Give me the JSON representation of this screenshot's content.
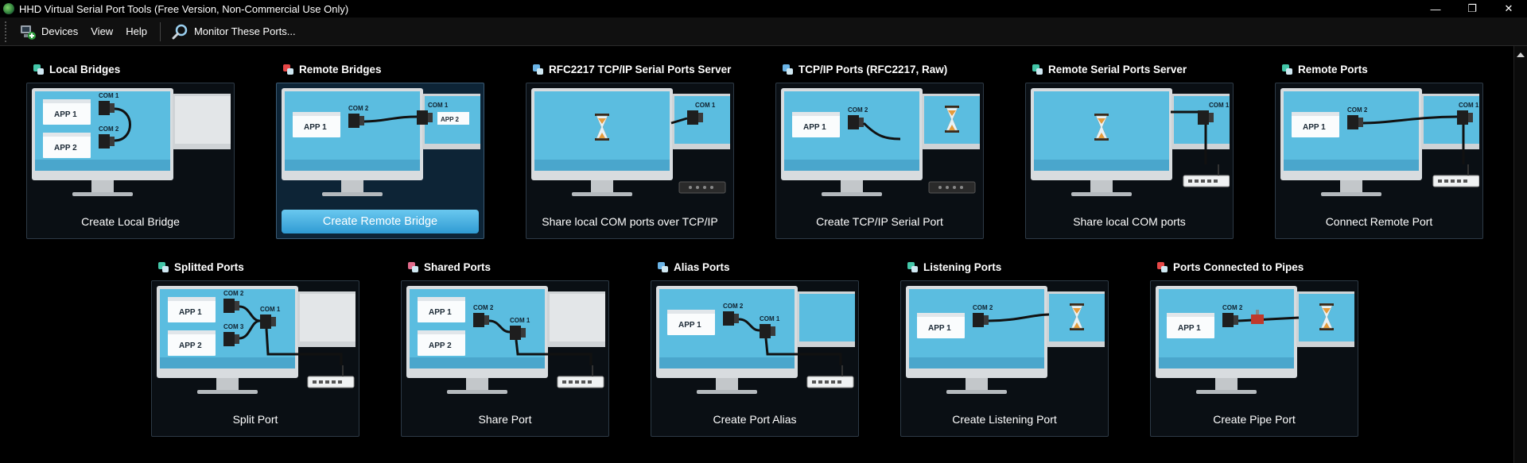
{
  "window": {
    "title": "HHD Virtual Serial Port Tools (Free Version, Non-Commercial Use Only)",
    "controls": {
      "minimize": "—",
      "restore": "❐",
      "close": "✕"
    }
  },
  "menu": {
    "devices": "Devices",
    "view": "View",
    "help": "Help",
    "monitor": "Monitor These Ports..."
  },
  "tiles": [
    {
      "title": "Local Bridges",
      "caption": "Create Local Bridge",
      "icon": "local-bridges-icon",
      "selected": false
    },
    {
      "title": "Remote Bridges",
      "caption": "Create Remote Bridge",
      "icon": "remote-bridges-icon",
      "selected": true
    },
    {
      "title": "RFC2217 TCP/IP Serial Ports Server",
      "caption": "Share local COM ports over TCP/IP",
      "icon": "rfc2217-server-icon",
      "selected": false
    },
    {
      "title": "TCP/IP Ports (RFC2217, Raw)",
      "caption": "Create TCP/IP Serial Port",
      "icon": "tcpip-ports-icon",
      "selected": false
    },
    {
      "title": "Remote Serial Ports Server",
      "caption": "Share local COM ports",
      "icon": "remote-server-icon",
      "selected": false
    },
    {
      "title": "Remote Ports",
      "caption": "Connect Remote Port",
      "icon": "remote-ports-icon",
      "selected": false
    },
    {
      "title": "Splitted Ports",
      "caption": "Split Port",
      "icon": "splitted-ports-icon",
      "selected": false
    },
    {
      "title": "Shared Ports",
      "caption": "Share Port",
      "icon": "shared-ports-icon",
      "selected": false
    },
    {
      "title": "Alias Ports",
      "caption": "Create Port Alias",
      "icon": "alias-ports-icon",
      "selected": false
    },
    {
      "title": "Listening Ports",
      "caption": "Create Listening Port",
      "icon": "listening-ports-icon",
      "selected": false
    },
    {
      "title": "Ports Connected to Pipes",
      "caption": "Create Pipe Port",
      "icon": "pipe-ports-icon",
      "selected": false
    }
  ],
  "art": {
    "app1": "APP 1",
    "app2": "APP 2",
    "com1": "COM 1",
    "com2": "COM 2",
    "com3": "COM 3"
  },
  "colors": {
    "accent": "#2f9bd3",
    "screen": "#5bbde0",
    "card_bg": "#0a0f14"
  }
}
